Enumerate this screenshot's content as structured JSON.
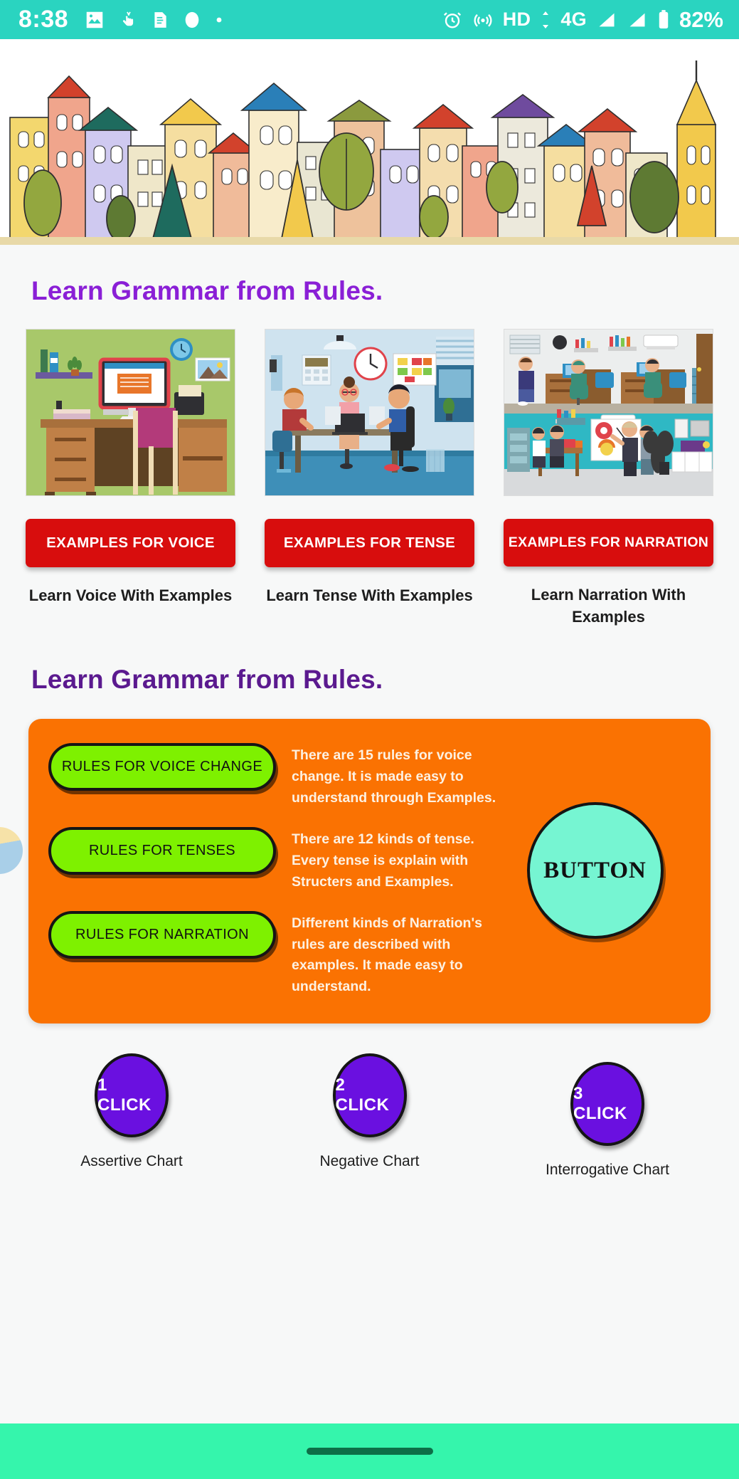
{
  "statusbar": {
    "time": "8:38",
    "left_icons": [
      "image-icon",
      "hand-tap-icon",
      "document-icon",
      "circle-icon",
      "dot-icon"
    ],
    "right_icons": [
      "alarm-icon",
      "hotspot-icon",
      "signal-bars-icon",
      "signal-bars-icon",
      "battery-icon"
    ],
    "hd_label": "HD",
    "network_label": "4G",
    "battery_percent": "82%"
  },
  "banner": {
    "name": "town-illustration-banner"
  },
  "sections": {
    "examples": {
      "heading": "Learn Grammar from Rules.",
      "cards": [
        {
          "image_name": "desk-office-illustration",
          "button_label": "EXAMPLES FOR VOICE",
          "caption": "Learn Voice With Examples"
        },
        {
          "image_name": "team-office-illustration",
          "button_label": "EXAMPLES FOR TENSE",
          "caption": "Learn Tense With Examples"
        },
        {
          "image_name": "classroom-office-illustration",
          "button_label": "EXAMPLES FOR NARRATION",
          "caption": "Learn Narration With Examples"
        }
      ]
    },
    "rules": {
      "heading": "Learn Grammar from Rules.",
      "items": [
        {
          "button_label": "RULES FOR VOICE CHANGE",
          "description": "There are 15 rules for voice change. It is made easy to understand through Examples."
        },
        {
          "button_label": "RULES FOR TENSES",
          "description": "There are 12 kinds of tense. Every tense is explain with Structers and Examples."
        },
        {
          "button_label": "RULES FOR NARRATION",
          "description": "Different kinds of Narration's rules are described with examples. It made easy to understand."
        }
      ],
      "big_button_label": "BUTTON"
    },
    "charts": [
      {
        "circle_label": "1 CLICK",
        "caption": "Assertive Chart"
      },
      {
        "circle_label": "2 CLICK",
        "caption": "Negative Chart"
      },
      {
        "circle_label": "3 CLICK",
        "caption": "Interrogative Chart"
      }
    ]
  },
  "colors": {
    "statusbar": "#2ad4c0",
    "navbar": "#35f5ac",
    "heading_purple": "#8a1fd6",
    "heading_dark_purple": "#5b1a8f",
    "red_button": "#d80d0d",
    "orange_panel": "#fa7202",
    "green_button": "#7ef100",
    "teal_circle": "#76f5d2",
    "purple_circle": "#6a10e0"
  },
  "navbar": {
    "name": "gesture-home-pill"
  }
}
